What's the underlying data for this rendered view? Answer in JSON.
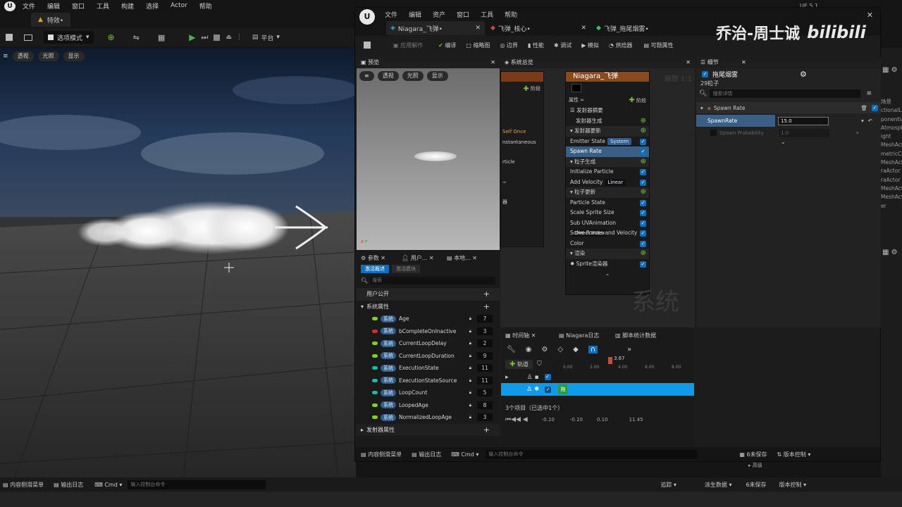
{
  "main": {
    "menu": [
      "文件",
      "编辑",
      "窗口",
      "工具",
      "构建",
      "选择",
      "Actor",
      "帮助"
    ],
    "tab": "特效•",
    "mode_button": "选项模式",
    "platform_button": "平台",
    "status_right": "UE 5.1",
    "viewport_buttons": [
      "透视",
      "光照",
      "显示"
    ]
  },
  "niagara": {
    "menu": [
      "文件",
      "编辑",
      "资产",
      "窗口",
      "工具",
      "帮助"
    ],
    "tabs": [
      "Niagara_飞弹•",
      "飞弹_核心•",
      "飞弹_拖尾烟雾•"
    ],
    "toolbar": [
      "应用解作",
      "编译",
      "缩略图",
      "边界",
      "性能",
      "调试",
      "模拟",
      "烘焙器",
      "可题属性"
    ],
    "preview": {
      "title": "预览",
      "buttons": [
        "透视",
        "光照",
        "显示"
      ]
    },
    "overview": {
      "title": "系统总览",
      "card_title": "Niagara_飞弹",
      "props_label": "属性",
      "stage_label": "阶段",
      "left_items": [
        "Self Once",
        "nstantaneous",
        "rticle",
        "∞",
        "器"
      ],
      "items": [
        {
          "label": "发射器摘要",
          "type": "head"
        },
        {
          "label": "发射器生成",
          "type": "sub"
        },
        {
          "label": "发射器更新",
          "type": "section"
        },
        {
          "label": "Emitter State",
          "tag": "System",
          "type": "item"
        },
        {
          "label": "Spawn Rate",
          "type": "item",
          "selected": true
        },
        {
          "label": "粒子生成",
          "type": "section"
        },
        {
          "label": "Initialize Particle",
          "type": "item"
        },
        {
          "label": "Add Velocity",
          "tag": "Linear",
          "type": "item"
        },
        {
          "label": "粒子更新",
          "type": "section"
        },
        {
          "label": "Particle State",
          "type": "item"
        },
        {
          "label": "Scale Sprite Size",
          "type": "item"
        },
        {
          "label": "Sub UVAnimation",
          "tag": "Direct Index",
          "type": "item"
        },
        {
          "label": "Solve Forces and Velocity",
          "type": "item"
        },
        {
          "label": "Color",
          "type": "item"
        },
        {
          "label": "渲染",
          "type": "section"
        },
        {
          "label": "Sprite渲染器",
          "type": "item"
        }
      ],
      "zoom_label": "缩放 1:1",
      "watermark": "系统"
    },
    "details": {
      "title": "细节",
      "emitter": "拖尾烟雾",
      "particles": "29粒子",
      "search_placeholder": "搜索详情",
      "section": "Spawn Rate",
      "row1_label": "SpawnRate",
      "row1_value": "15.0",
      "row2_label": "Spawn Probability",
      "row2_value": "1.0"
    },
    "params": {
      "tabs": [
        "参数",
        "用户...",
        "本地..."
      ],
      "subtabs": [
        "激活概述",
        "激活模块"
      ],
      "search_placeholder": "搜索",
      "user_exposed": "用户公开",
      "system_props": "系统属性",
      "emitter_props": "发射器属性",
      "system_tag": "系统",
      "rows": [
        {
          "name": "Age",
          "count": "7",
          "color": "#7ed321"
        },
        {
          "name": "bCompleteOnInactive",
          "count": "3",
          "color": "#c0392b"
        },
        {
          "name": "CurrentLoopDelay",
          "count": "2",
          "color": "#7ed321"
        },
        {
          "name": "CurrentLoopDuration",
          "count": "9",
          "color": "#7ed321"
        },
        {
          "name": "ExecutionState",
          "count": "11",
          "color": "#1abc9c"
        },
        {
          "name": "ExecutionStateSource",
          "count": "11",
          "color": "#1abc9c"
        },
        {
          "name": "LoopCount",
          "count": "5",
          "color": "#1abc9c"
        },
        {
          "name": "LoopedAge",
          "count": "8",
          "color": "#7ed321"
        },
        {
          "name": "NormalizedLoopAge",
          "count": "3",
          "color": "#7ed321"
        }
      ]
    },
    "timeline": {
      "tabs": [
        "时间轴",
        "Niagara日志",
        "脚本统计数据"
      ],
      "track_button": "轨道",
      "time_marker": "3.67",
      "ticks": [
        "0.00",
        "2.00",
        "4.00",
        "6.00",
        "8.00"
      ],
      "track_label": "拖",
      "items_text": "3个项目（已选中1个）",
      "range": [
        "-0.10",
        "-0.10",
        "0.10",
        "11.45"
      ]
    },
    "statusbar": {
      "content": "内容侧滑菜单",
      "log": "输出日志",
      "cmd": "Cmd",
      "console_placeholder": "输入控制台命令",
      "unsaved": "6未保存",
      "source": "版本控制"
    }
  },
  "bottom": {
    "content": "内容侧滑菜单",
    "log": "输出日志",
    "cmd": "Cmd",
    "console_placeholder": "输入控制台命令",
    "right": [
      "追踪",
      "派生数据",
      "6未保存",
      "版本控制"
    ],
    "advanced": "高级"
  },
  "watermark": {
    "text": "乔治-周士诚",
    "brand": "bilibili"
  },
  "outliner_fragments": [
    "场景",
    "ctionalLig",
    "ponentialHe",
    "Atmosphe",
    "ight",
    "MeshAct",
    "metricClo",
    "MeshAct",
    "raActor",
    "raActor",
    "MeshAct",
    "MeshAct",
    "er"
  ]
}
